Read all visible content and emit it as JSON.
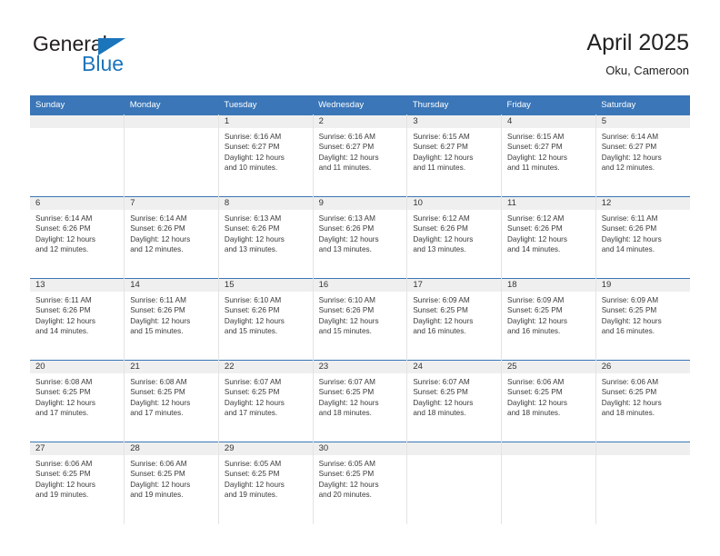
{
  "brand": {
    "name_part1": "General",
    "name_part2": "Blue",
    "icon": "triangle-logo-icon",
    "accent_color": "#1b75bb"
  },
  "header": {
    "title": "April 2025",
    "subtitle": "Oku, Cameroon"
  },
  "theme": {
    "header_blue": "#3a76b8",
    "date_band_gray": "#efefef"
  },
  "weekday_headers": [
    "Sunday",
    "Monday",
    "Tuesday",
    "Wednesday",
    "Thursday",
    "Friday",
    "Saturday"
  ],
  "labels": {
    "sunrise_prefix": "Sunrise:",
    "sunset_prefix": "Sunset:",
    "daylight_prefix": "Daylight:"
  },
  "weeks": [
    [
      {
        "date": "",
        "empty": true
      },
      {
        "date": "",
        "empty": true
      },
      {
        "date": "1",
        "sunrise": "Sunrise: 6:16 AM",
        "sunset": "Sunset: 6:27 PM",
        "daylight1": "Daylight: 12 hours",
        "daylight2": "and 10 minutes."
      },
      {
        "date": "2",
        "sunrise": "Sunrise: 6:16 AM",
        "sunset": "Sunset: 6:27 PM",
        "daylight1": "Daylight: 12 hours",
        "daylight2": "and 11 minutes."
      },
      {
        "date": "3",
        "sunrise": "Sunrise: 6:15 AM",
        "sunset": "Sunset: 6:27 PM",
        "daylight1": "Daylight: 12 hours",
        "daylight2": "and 11 minutes."
      },
      {
        "date": "4",
        "sunrise": "Sunrise: 6:15 AM",
        "sunset": "Sunset: 6:27 PM",
        "daylight1": "Daylight: 12 hours",
        "daylight2": "and 11 minutes."
      },
      {
        "date": "5",
        "sunrise": "Sunrise: 6:14 AM",
        "sunset": "Sunset: 6:27 PM",
        "daylight1": "Daylight: 12 hours",
        "daylight2": "and 12 minutes."
      }
    ],
    [
      {
        "date": "6",
        "sunrise": "Sunrise: 6:14 AM",
        "sunset": "Sunset: 6:26 PM",
        "daylight1": "Daylight: 12 hours",
        "daylight2": "and 12 minutes."
      },
      {
        "date": "7",
        "sunrise": "Sunrise: 6:14 AM",
        "sunset": "Sunset: 6:26 PM",
        "daylight1": "Daylight: 12 hours",
        "daylight2": "and 12 minutes."
      },
      {
        "date": "8",
        "sunrise": "Sunrise: 6:13 AM",
        "sunset": "Sunset: 6:26 PM",
        "daylight1": "Daylight: 12 hours",
        "daylight2": "and 13 minutes."
      },
      {
        "date": "9",
        "sunrise": "Sunrise: 6:13 AM",
        "sunset": "Sunset: 6:26 PM",
        "daylight1": "Daylight: 12 hours",
        "daylight2": "and 13 minutes."
      },
      {
        "date": "10",
        "sunrise": "Sunrise: 6:12 AM",
        "sunset": "Sunset: 6:26 PM",
        "daylight1": "Daylight: 12 hours",
        "daylight2": "and 13 minutes."
      },
      {
        "date": "11",
        "sunrise": "Sunrise: 6:12 AM",
        "sunset": "Sunset: 6:26 PM",
        "daylight1": "Daylight: 12 hours",
        "daylight2": "and 14 minutes."
      },
      {
        "date": "12",
        "sunrise": "Sunrise: 6:11 AM",
        "sunset": "Sunset: 6:26 PM",
        "daylight1": "Daylight: 12 hours",
        "daylight2": "and 14 minutes."
      }
    ],
    [
      {
        "date": "13",
        "sunrise": "Sunrise: 6:11 AM",
        "sunset": "Sunset: 6:26 PM",
        "daylight1": "Daylight: 12 hours",
        "daylight2": "and 14 minutes."
      },
      {
        "date": "14",
        "sunrise": "Sunrise: 6:11 AM",
        "sunset": "Sunset: 6:26 PM",
        "daylight1": "Daylight: 12 hours",
        "daylight2": "and 15 minutes."
      },
      {
        "date": "15",
        "sunrise": "Sunrise: 6:10 AM",
        "sunset": "Sunset: 6:26 PM",
        "daylight1": "Daylight: 12 hours",
        "daylight2": "and 15 minutes."
      },
      {
        "date": "16",
        "sunrise": "Sunrise: 6:10 AM",
        "sunset": "Sunset: 6:26 PM",
        "daylight1": "Daylight: 12 hours",
        "daylight2": "and 15 minutes."
      },
      {
        "date": "17",
        "sunrise": "Sunrise: 6:09 AM",
        "sunset": "Sunset: 6:25 PM",
        "daylight1": "Daylight: 12 hours",
        "daylight2": "and 16 minutes."
      },
      {
        "date": "18",
        "sunrise": "Sunrise: 6:09 AM",
        "sunset": "Sunset: 6:25 PM",
        "daylight1": "Daylight: 12 hours",
        "daylight2": "and 16 minutes."
      },
      {
        "date": "19",
        "sunrise": "Sunrise: 6:09 AM",
        "sunset": "Sunset: 6:25 PM",
        "daylight1": "Daylight: 12 hours",
        "daylight2": "and 16 minutes."
      }
    ],
    [
      {
        "date": "20",
        "sunrise": "Sunrise: 6:08 AM",
        "sunset": "Sunset: 6:25 PM",
        "daylight1": "Daylight: 12 hours",
        "daylight2": "and 17 minutes."
      },
      {
        "date": "21",
        "sunrise": "Sunrise: 6:08 AM",
        "sunset": "Sunset: 6:25 PM",
        "daylight1": "Daylight: 12 hours",
        "daylight2": "and 17 minutes."
      },
      {
        "date": "22",
        "sunrise": "Sunrise: 6:07 AM",
        "sunset": "Sunset: 6:25 PM",
        "daylight1": "Daylight: 12 hours",
        "daylight2": "and 17 minutes."
      },
      {
        "date": "23",
        "sunrise": "Sunrise: 6:07 AM",
        "sunset": "Sunset: 6:25 PM",
        "daylight1": "Daylight: 12 hours",
        "daylight2": "and 18 minutes."
      },
      {
        "date": "24",
        "sunrise": "Sunrise: 6:07 AM",
        "sunset": "Sunset: 6:25 PM",
        "daylight1": "Daylight: 12 hours",
        "daylight2": "and 18 minutes."
      },
      {
        "date": "25",
        "sunrise": "Sunrise: 6:06 AM",
        "sunset": "Sunset: 6:25 PM",
        "daylight1": "Daylight: 12 hours",
        "daylight2": "and 18 minutes."
      },
      {
        "date": "26",
        "sunrise": "Sunrise: 6:06 AM",
        "sunset": "Sunset: 6:25 PM",
        "daylight1": "Daylight: 12 hours",
        "daylight2": "and 18 minutes."
      }
    ],
    [
      {
        "date": "27",
        "sunrise": "Sunrise: 6:06 AM",
        "sunset": "Sunset: 6:25 PM",
        "daylight1": "Daylight: 12 hours",
        "daylight2": "and 19 minutes."
      },
      {
        "date": "28",
        "sunrise": "Sunrise: 6:06 AM",
        "sunset": "Sunset: 6:25 PM",
        "daylight1": "Daylight: 12 hours",
        "daylight2": "and 19 minutes."
      },
      {
        "date": "29",
        "sunrise": "Sunrise: 6:05 AM",
        "sunset": "Sunset: 6:25 PM",
        "daylight1": "Daylight: 12 hours",
        "daylight2": "and 19 minutes."
      },
      {
        "date": "30",
        "sunrise": "Sunrise: 6:05 AM",
        "sunset": "Sunset: 6:25 PM",
        "daylight1": "Daylight: 12 hours",
        "daylight2": "and 20 minutes."
      },
      {
        "date": "",
        "empty": true
      },
      {
        "date": "",
        "empty": true
      },
      {
        "date": "",
        "empty": true
      }
    ]
  ]
}
